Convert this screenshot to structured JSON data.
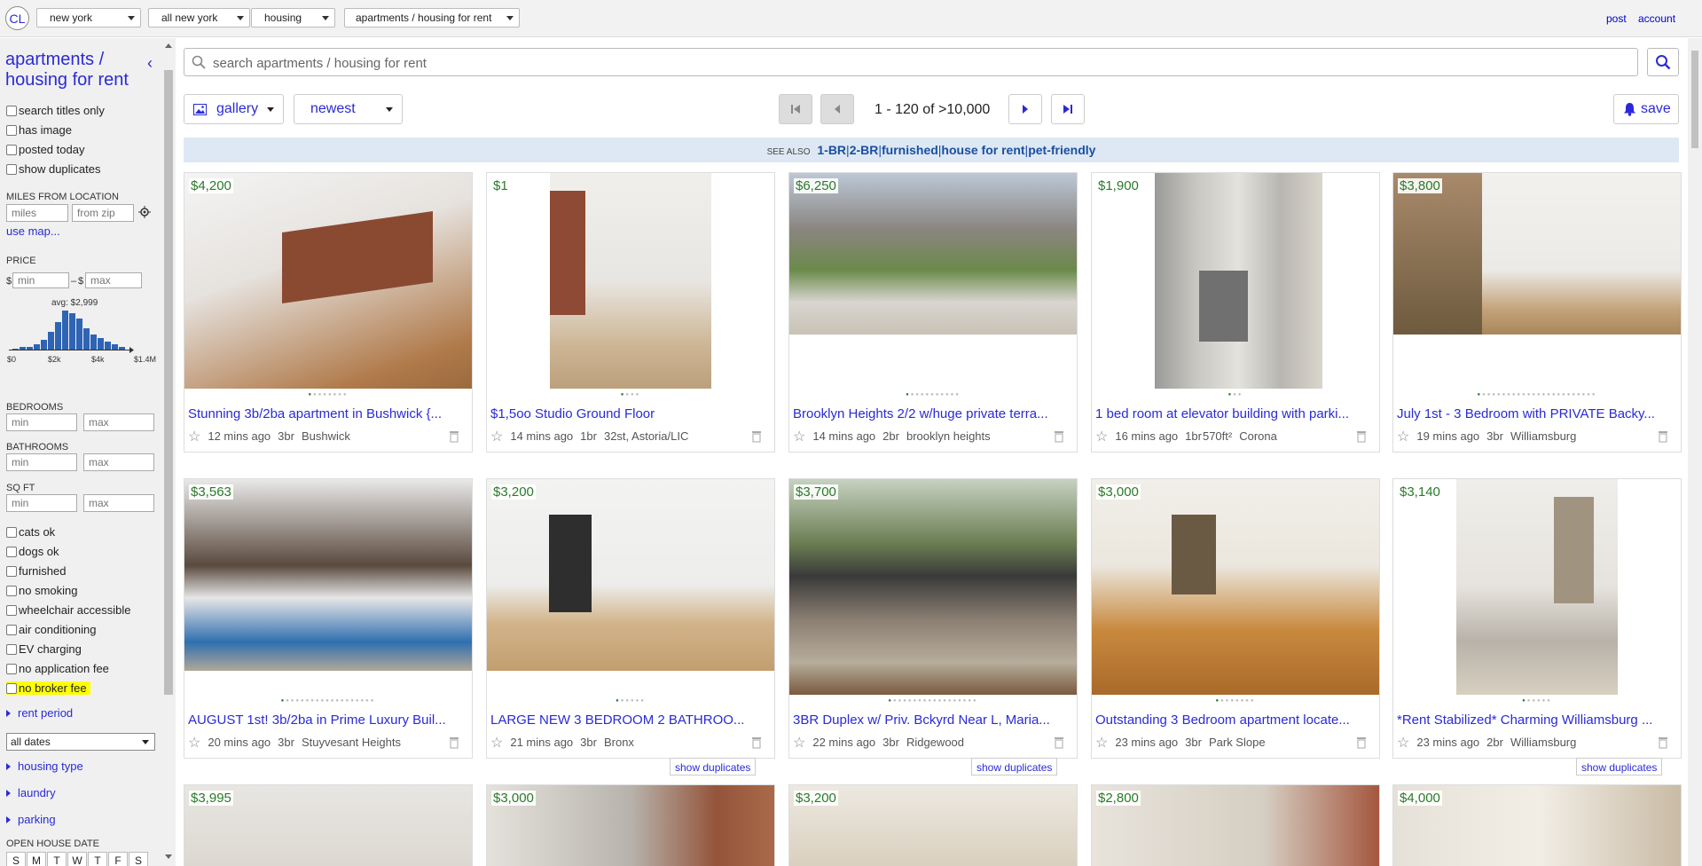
{
  "topbar": {
    "logo": "CL",
    "selectors": [
      "new york",
      "all new york",
      "housing",
      "apartments / housing for rent"
    ],
    "links": [
      "post",
      "account"
    ]
  },
  "sidebar": {
    "title": "apartments / housing for rent",
    "checks_top": [
      "search titles only",
      "has image",
      "posted today",
      "show duplicates"
    ],
    "miles_label": "MILES FROM LOCATION",
    "miles_ph": "miles",
    "zip_ph": "from zip",
    "use_map": "use map...",
    "price_label": "PRICE",
    "currency": "$",
    "dash": "–",
    "min_ph": "min",
    "max_ph": "max",
    "hist_avg": "avg: $2,999",
    "hist_ticks": [
      "$0",
      "$2k",
      "$4k",
      "$1.4M"
    ],
    "hist_values": [
      1,
      2,
      2,
      4,
      8,
      14,
      22,
      31,
      29,
      25,
      17,
      12,
      9,
      6,
      4,
      2
    ],
    "bedrooms_label": "BEDROOMS",
    "bathrooms_label": "BATHROOMS",
    "sqft_label": "SQ FT",
    "checks_mid": [
      "cats ok",
      "dogs ok",
      "furnished",
      "no smoking",
      "wheelchair accessible",
      "air conditioning",
      "EV charging",
      "no application fee",
      "no broker fee"
    ],
    "rent_period": "rent period",
    "dates_value": "all dates",
    "expanders": [
      "housing type",
      "laundry",
      "parking"
    ],
    "open_house_label": "OPEN HOUSE DATE",
    "days": [
      "S",
      "M",
      "T",
      "W",
      "T",
      "F",
      "S"
    ]
  },
  "search": {
    "placeholder": "search apartments / housing for rent"
  },
  "controls": {
    "view": "gallery",
    "sort": "newest",
    "range": "1 - 120 of >10,000",
    "save": "save"
  },
  "seealso": {
    "label": "SEE ALSO",
    "links": [
      "1-BR",
      "2-BR",
      "furnished",
      "house for rent",
      "pet-friendly"
    ]
  },
  "colors": {
    "accent": "#2a2ad8",
    "price": "#2a7a2a",
    "highlight": "#ffff00"
  },
  "listings": [
    {
      "price": "$4,200",
      "title": "Stunning 3b/2ba apartment in Bushwick {...",
      "time": "12 mins ago",
      "br": "3br",
      "sqft": "",
      "loc": "Bushwick"
    },
    {
      "price": "$1",
      "title": "$1,5oo Studio Ground Floor",
      "time": "14 mins ago",
      "br": "1br",
      "sqft": "",
      "loc": "32st, Astoria/LIC"
    },
    {
      "price": "$6,250",
      "title": "Brooklyn Heights 2/2 w/huge private terra...",
      "time": "14 mins ago",
      "br": "2br",
      "sqft": "",
      "loc": "brooklyn heights"
    },
    {
      "price": "$1,900",
      "title": "1 bed room at elevator building with parki...",
      "time": "16 mins ago",
      "br": "1br",
      "sqft": "570ft²",
      "loc": "Corona"
    },
    {
      "price": "$3,800",
      "title": "July 1st - 3 Bedroom with PRIVATE Backy...",
      "time": "19 mins ago",
      "br": "3br",
      "sqft": "",
      "loc": "Williamsburg"
    },
    {
      "price": "$3,563",
      "title": "AUGUST 1st! 3b/2ba in Prime Luxury Buil...",
      "time": "20 mins ago",
      "br": "3br",
      "sqft": "",
      "loc": "Stuyvesant Heights"
    },
    {
      "price": "$3,200",
      "title": "LARGE NEW 3 BEDROOM 2 BATHROO...",
      "time": "21 mins ago",
      "br": "3br",
      "sqft": "",
      "loc": "Bronx"
    },
    {
      "price": "$3,700",
      "title": "3BR Duplex w/ Priv. Bckyrd Near L, Maria...",
      "time": "22 mins ago",
      "br": "3br",
      "sqft": "",
      "loc": "Ridgewood"
    },
    {
      "price": "$3,000",
      "title": "Outstanding 3 Bedroom apartment locate...",
      "time": "23 mins ago",
      "br": "3br",
      "sqft": "",
      "loc": "Park Slope"
    },
    {
      "price": "$3,140",
      "title": "*Rent Stabilized* Charming Williamsburg ...",
      "time": "23 mins ago",
      "br": "2br",
      "sqft": "",
      "loc": "Williamsburg"
    },
    {
      "price": "$3,995"
    },
    {
      "price": "$3,000"
    },
    {
      "price": "$3,200"
    },
    {
      "price": "$2,800"
    },
    {
      "price": "$4,000"
    }
  ],
  "show_duplicates": "show duplicates"
}
